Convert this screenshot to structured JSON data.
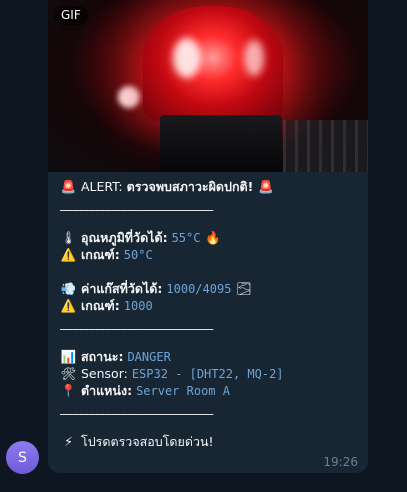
{
  "avatar": {
    "letter": "S"
  },
  "gif": {
    "badge": "GIF"
  },
  "message": {
    "alert_prefix": "ALERT:",
    "alert_text": "ตรวจพบสภาวะผิดปกติ!",
    "separator": "_____________________________",
    "temp_label": "อุณหภูมิที่วัดได้:",
    "temp_value": "55°C",
    "temp_threshold_label": "เกณฑ์:",
    "temp_threshold_value": "50°C",
    "gas_label": "ค่าแก๊สที่วัดได้:",
    "gas_value": "1000/4095",
    "gas_threshold_label": "เกณฑ์:",
    "gas_threshold_value": "1000",
    "status_label": "สถานะ:",
    "status_value": "DANGER",
    "sensor_label": "Sensor:",
    "sensor_value": "ESP32 - [DHT22, MQ-2]",
    "location_label": "ตำแหน่ง:",
    "location_value": "Server Room A",
    "footer_text": "โปรดตรวจสอบโดยด่วน!",
    "time": "19:26"
  },
  "colors": {
    "background": "#0e1621",
    "bubble": "#182533",
    "mono_accent": "#6ea4d6",
    "avatar": "#7b68ee"
  },
  "icons": [
    "siren-icon",
    "thermometer-icon",
    "fire-icon",
    "warning-icon",
    "gas-icon",
    "fog-icon",
    "chart-icon",
    "tools-icon",
    "pin-icon",
    "lightning-icon"
  ]
}
